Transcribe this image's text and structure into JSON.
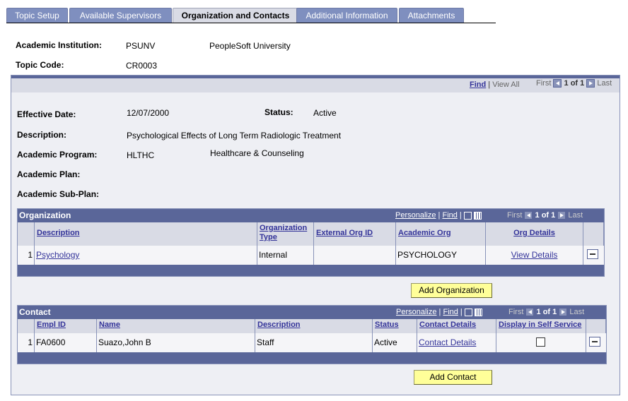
{
  "tabs": [
    {
      "label": "Topic Setup",
      "active": false
    },
    {
      "label": "Available Supervisors",
      "active": false
    },
    {
      "label": "Organization and Contacts",
      "active": true
    },
    {
      "label": "Additional Information",
      "active": false
    },
    {
      "label": "Attachments",
      "active": false
    }
  ],
  "header": {
    "institution_label": "Academic Institution:",
    "institution_code": "PSUNV",
    "institution_name": "PeopleSoft University",
    "topic_label": "Topic Code:",
    "topic_code": "CR0003"
  },
  "panel_nav": {
    "find": "Find",
    "view_all": "View All",
    "first": "First",
    "count": "1 of 1",
    "last": "Last"
  },
  "details": {
    "effdate_label": "Effective Date:",
    "effdate": "12/07/2000",
    "status_label": "Status:",
    "status": "Active",
    "description_label": "Description:",
    "description": "Psychological Effects of Long Term Radiologic Treatment",
    "program_label": "Academic Program:",
    "program_code": "HLTHC",
    "program_name": "Healthcare & Counseling",
    "plan_label": "Academic Plan:",
    "subplan_label": "Academic Sub-Plan:"
  },
  "organization": {
    "title": "Organization",
    "personalize": "Personalize",
    "find": "Find",
    "first": "First",
    "count": "1 of 1",
    "last": "Last",
    "columns": [
      "Description",
      "Organization Type",
      "External Org ID",
      "Academic Org",
      "Org Details"
    ],
    "rows": [
      {
        "num": "1",
        "description": "Psychology",
        "type": "Internal",
        "external_id": "",
        "academic_org": "PSYCHOLOGY",
        "details": "View Details"
      }
    ],
    "add_button": "Add Organization"
  },
  "contact": {
    "title": "Contact",
    "personalize": "Personalize",
    "find": "Find",
    "first": "First",
    "count": "1 of 1",
    "last": "Last",
    "columns": [
      "Empl ID",
      "Name",
      "Description",
      "Status",
      "Contact Details",
      "Display in Self Service"
    ],
    "rows": [
      {
        "num": "1",
        "empl_id": "FA0600",
        "name": "Suazo,John B",
        "description": "Staff",
        "status": "Active",
        "details": "Contact Details",
        "self_service": false
      }
    ],
    "add_button": "Add Contact"
  },
  "icons": {
    "prev": "chevron-left-icon",
    "next": "chevron-right-icon",
    "zoom": "view-grid-icon",
    "download": "download-icon",
    "delete_row": "minus-icon"
  },
  "colors": {
    "header_bar": "#5a6699",
    "tab_inactive": "#7f8fbf",
    "button_yellow": "#ffff99",
    "link": "#333399"
  }
}
